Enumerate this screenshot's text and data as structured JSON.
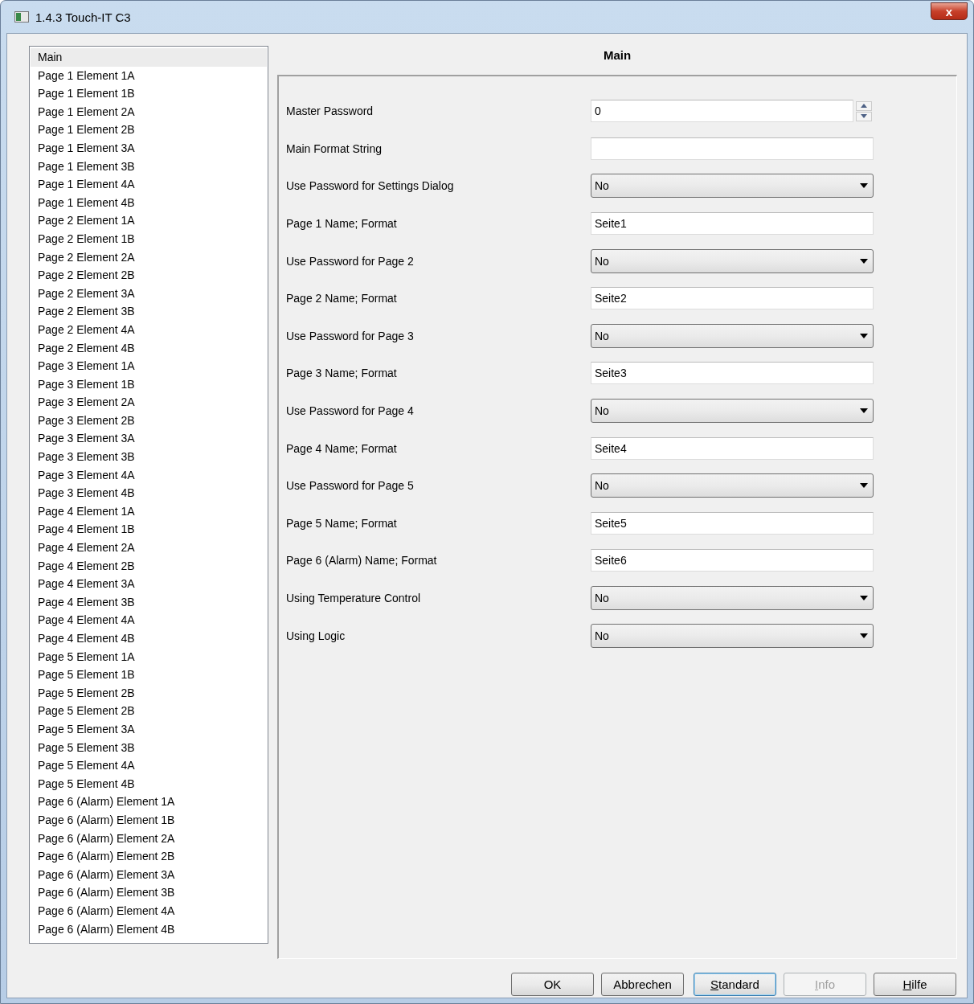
{
  "window": {
    "title": "1.4.3 Touch-IT C3",
    "close_label": "x"
  },
  "sidebar": {
    "items": [
      {
        "label": "Main",
        "selected": true
      },
      {
        "label": "Page 1 Element 1A",
        "selected": false
      },
      {
        "label": "Page 1 Element 1B",
        "selected": false
      },
      {
        "label": "Page 1 Element 2A",
        "selected": false
      },
      {
        "label": "Page 1 Element 2B",
        "selected": false
      },
      {
        "label": "Page 1 Element 3A",
        "selected": false
      },
      {
        "label": "Page 1 Element 3B",
        "selected": false
      },
      {
        "label": "Page 1 Element 4A",
        "selected": false
      },
      {
        "label": "Page 1 Element 4B",
        "selected": false
      },
      {
        "label": "Page 2 Element 1A",
        "selected": false
      },
      {
        "label": "Page 2 Element 1B",
        "selected": false
      },
      {
        "label": "Page 2 Element 2A",
        "selected": false
      },
      {
        "label": "Page 2 Element 2B",
        "selected": false
      },
      {
        "label": "Page 2 Element 3A",
        "selected": false
      },
      {
        "label": "Page 2 Element 3B",
        "selected": false
      },
      {
        "label": "Page 2 Element 4A",
        "selected": false
      },
      {
        "label": "Page 2 Element 4B",
        "selected": false
      },
      {
        "label": "Page 3 Element 1A",
        "selected": false
      },
      {
        "label": "Page 3 Element 1B",
        "selected": false
      },
      {
        "label": "Page 3 Element 2A",
        "selected": false
      },
      {
        "label": "Page 3 Element 2B",
        "selected": false
      },
      {
        "label": "Page 3 Element 3A",
        "selected": false
      },
      {
        "label": "Page 3 Element 3B",
        "selected": false
      },
      {
        "label": "Page 3 Element 4A",
        "selected": false
      },
      {
        "label": "Page 3 Element 4B",
        "selected": false
      },
      {
        "label": "Page 4 Element 1A",
        "selected": false
      },
      {
        "label": "Page 4 Element 1B",
        "selected": false
      },
      {
        "label": "Page 4 Element 2A",
        "selected": false
      },
      {
        "label": "Page 4 Element 2B",
        "selected": false
      },
      {
        "label": "Page 4 Element 3A",
        "selected": false
      },
      {
        "label": "Page 4 Element 3B",
        "selected": false
      },
      {
        "label": "Page 4 Element 4A",
        "selected": false
      },
      {
        "label": "Page 4 Element 4B",
        "selected": false
      },
      {
        "label": "Page 5 Element 1A",
        "selected": false
      },
      {
        "label": "Page 5 Element 1B",
        "selected": false
      },
      {
        "label": "Page 5 Element 2B",
        "selected": false
      },
      {
        "label": "Page 5 Element 2B",
        "selected": false
      },
      {
        "label": "Page 5 Element 3A",
        "selected": false
      },
      {
        "label": "Page 5 Element 3B",
        "selected": false
      },
      {
        "label": "Page 5 Element 4A",
        "selected": false
      },
      {
        "label": "Page 5 Element 4B",
        "selected": false
      },
      {
        "label": "Page 6 (Alarm) Element 1A",
        "selected": false
      },
      {
        "label": "Page 6 (Alarm) Element 1B",
        "selected": false
      },
      {
        "label": "Page 6 (Alarm) Element 2A",
        "selected": false
      },
      {
        "label": "Page 6 (Alarm) Element 2B",
        "selected": false
      },
      {
        "label": "Page 6 (Alarm) Element 3A",
        "selected": false
      },
      {
        "label": "Page 6 (Alarm) Element 3B",
        "selected": false
      },
      {
        "label": "Page 6 (Alarm) Element 4A",
        "selected": false
      },
      {
        "label": "Page 6 (Alarm) Element 4B",
        "selected": false
      }
    ]
  },
  "panel": {
    "title": "Main",
    "fields": [
      {
        "label": "Master Password",
        "kind": "spinner",
        "value": "0"
      },
      {
        "label": "Main Format String",
        "kind": "text"
      },
      {
        "label": "Use Password for Settings Dialog",
        "kind": "dropdown",
        "value": "No"
      },
      {
        "label": "Page 1 Name; Format",
        "kind": "text",
        "value": "Seite1"
      },
      {
        "label": "Use Password for Page 2",
        "kind": "dropdown",
        "value": "No"
      },
      {
        "label": "Page 2 Name; Format",
        "kind": "text",
        "value": "Seite2"
      },
      {
        "label": "Use Password for Page 3",
        "kind": "dropdown",
        "value": "No"
      },
      {
        "label": "Page 3 Name; Format",
        "kind": "text",
        "value": "Seite3"
      },
      {
        "label": "Use Password for Page 4",
        "kind": "dropdown",
        "value": "No"
      },
      {
        "label": "Page 4 Name; Format",
        "kind": "text",
        "value": "Seite4"
      },
      {
        "label": "Use Password for Page 5",
        "kind": "dropdown",
        "value": "No"
      },
      {
        "label": "Page 5 Name; Format",
        "kind": "text",
        "value": "Seite5"
      },
      {
        "label": "Page 6 (Alarm) Name; Format",
        "kind": "text",
        "value": "Seite6"
      },
      {
        "label": "Using Temperature Control",
        "kind": "dropdown",
        "value": "No"
      },
      {
        "label": "Using Logic",
        "kind": "dropdown",
        "value": "No"
      }
    ]
  },
  "buttons": [
    {
      "label": "OK",
      "default": false,
      "disabled": false,
      "first_letter_underlined": false
    },
    {
      "label": "Abbrechen",
      "default": false,
      "disabled": false,
      "first_letter_underlined": false
    },
    {
      "label": "Standard",
      "default": true,
      "disabled": false,
      "first_letter_underlined": true
    },
    {
      "label": "Info",
      "default": false,
      "disabled": true,
      "first_letter_underlined": true
    },
    {
      "label": "Hilfe",
      "default": false,
      "disabled": false,
      "first_letter_underlined": true
    }
  ]
}
